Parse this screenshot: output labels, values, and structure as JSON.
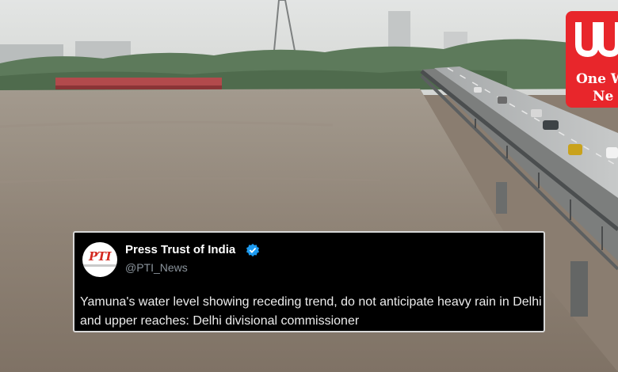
{
  "tweet": {
    "display_name": "Press Trust of India",
    "handle": "@PTI_News",
    "text": "Yamuna's water level showing receding trend, do not anticipate heavy rain in Delhi and upper reaches: Delhi divisional commissioner",
    "avatar_label": "PTI",
    "verified_icon": "verified-badge-icon",
    "verified_color": "#1d9bf0"
  },
  "brand_logo": {
    "line1": "One W",
    "line2": "Ne",
    "color": "#e8262b"
  }
}
